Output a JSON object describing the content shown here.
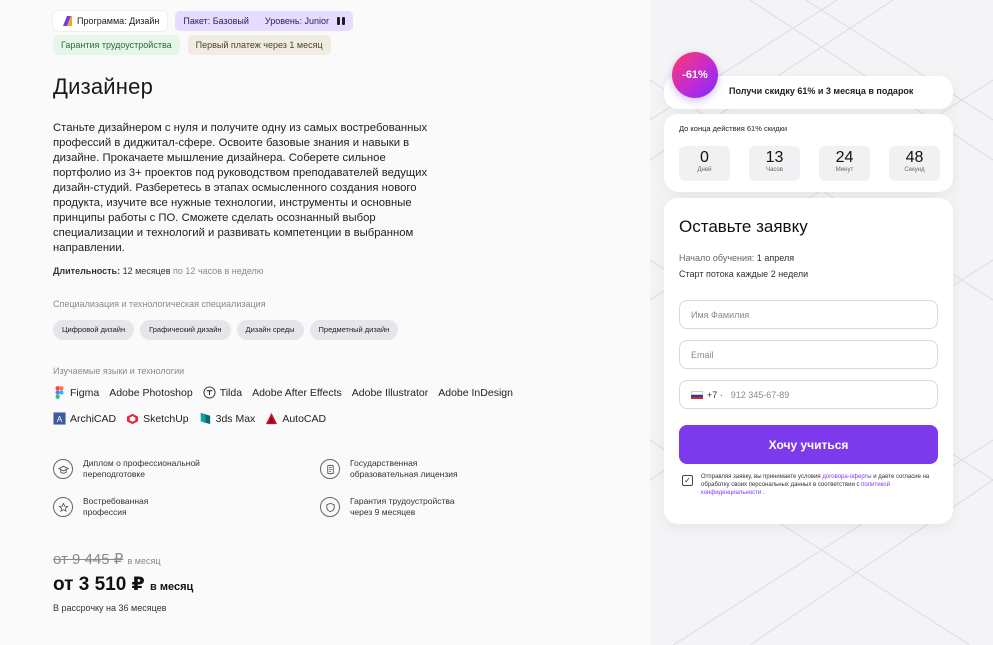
{
  "tags": {
    "program": "Программа: Дизайн",
    "package": "Пакет: Базовый",
    "level": "Уровень: Junior",
    "guarantee": "Гарантия трудоустройства",
    "first_payment": "Первый платеж через 1 месяц"
  },
  "title": "Дизайнер",
  "description": "Станьте дизайнером с нуля и получите одну из самых востребованных профессий в диджитал-сфере. Освоите базовые знания и навыки в дизайне. Прокачаете мышление дизайнера. Соберете сильное портфолио из 3+ проектов под руководством преподавателей ведущих дизайн-студий. Разберетесь в этапах осмысленного создания нового продукта, изучите все нужные технологии, инструменты и основные принципы работы с ПО. Сможете сделать осознанный выбор специализации и технологий и развивать компетенции в выбранном направлении.",
  "duration": {
    "label": "Длительность:",
    "value": "12 месяцев",
    "hours": "по 12 часов в неделю"
  },
  "specialization": {
    "title": "Специализация и технологическая специализация",
    "chips": [
      "Цифровой дизайн",
      "Графический дизайн",
      "Дизайн среды",
      "Предметный дизайн"
    ]
  },
  "technologies": {
    "title": "Изучаемые языки и технологии",
    "row1": [
      "Figma",
      "Adobe Photoshop",
      "Tilda",
      "Adobe After Effects",
      "Adobe Illustrator",
      "Adobe InDesign"
    ],
    "row2": [
      "ArchiCAD",
      "SketchUp",
      "3ds Max",
      "AutoCAD"
    ]
  },
  "features": [
    {
      "icon": "graduation-icon",
      "text1": "Диплом о профессиональной",
      "text2": "переподготовке"
    },
    {
      "icon": "license-icon",
      "text1": "Государственная",
      "text2": "образовательная лицензия"
    },
    {
      "icon": "star-icon",
      "text1": "Востребованная",
      "text2": "профессия"
    },
    {
      "icon": "shield-icon",
      "text1": "Гарантия трудоустройства",
      "text2": "через 9 месяцев"
    }
  ],
  "price": {
    "old": "от 9 445 ₽",
    "old_unit": "в месяц",
    "new": "от 3 510 ₽",
    "new_unit": "в месяц",
    "installments": "В рассрочку на 36 месяцев"
  },
  "promo": {
    "badge": "-61%",
    "text": "Получи скидку 61% и 3 месяца в подарок"
  },
  "timer": {
    "title": "До конца действия 61% скидки",
    "units": [
      {
        "value": "0",
        "label": "Дней"
      },
      {
        "value": "13",
        "label": "Часов"
      },
      {
        "value": "24",
        "label": "Минут"
      },
      {
        "value": "48",
        "label": "Секунд"
      }
    ]
  },
  "form": {
    "title": "Оставьте заявку",
    "start_label": "Начало обучения:",
    "start_value": "1 апреля",
    "stream": "Старт потока каждые 2 недели",
    "name_placeholder": "Имя Фамилия",
    "email_placeholder": "Email",
    "phone_code": "+7 ·",
    "phone_placeholder": "912 345-67-89",
    "submit": "Хочу учиться",
    "consent_1": "Отправляя заявку, вы принимаете условия ",
    "consent_link1": "договора-оферты",
    "consent_2": " и даете согласие на обработку своих персональных данных в соответствии с ",
    "consent_link2": "политикой конфиденциальности",
    "consent_3": " ."
  },
  "colors": {
    "accent": "#7c3aed",
    "badge_start": "#ff3a6a",
    "badge_end": "#7a2cff"
  }
}
